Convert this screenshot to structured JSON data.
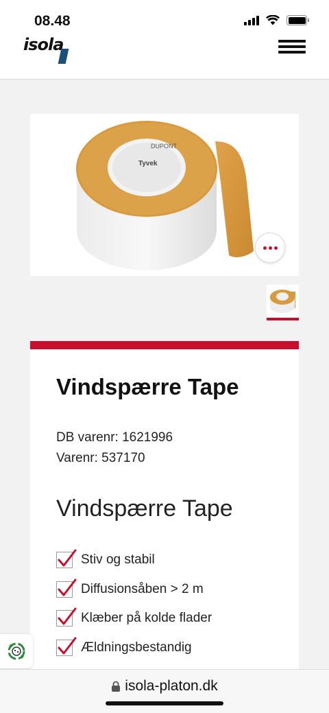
{
  "status_bar": {
    "time": "08.48"
  },
  "header": {
    "logo_text": "isola",
    "menu_icon": "hamburger-icon"
  },
  "gallery": {
    "main_image_alt": "tape-roll-image",
    "more_icon": "more-options-icon",
    "tape_brand_label": "Tyvek",
    "tape_maker_label": "DUPONT"
  },
  "product": {
    "title": "Vindspærre Tape",
    "db_varenr": "DB varenr: 1621996",
    "varenr": "Varenr: 537170",
    "subtitle": "Vindspærre Tape",
    "features": [
      {
        "label": "Stiv og stabil"
      },
      {
        "label": "Diffusionsåben > 2 m"
      },
      {
        "label": "Klæber på kolde flader"
      },
      {
        "label": "Ældningsbestandig"
      }
    ]
  },
  "browser": {
    "url": "isola-platon.dk"
  },
  "colors": {
    "accent": "#c8102e",
    "logo_blue": "#1a4f7a",
    "tape_orange": "#d79a3c"
  }
}
